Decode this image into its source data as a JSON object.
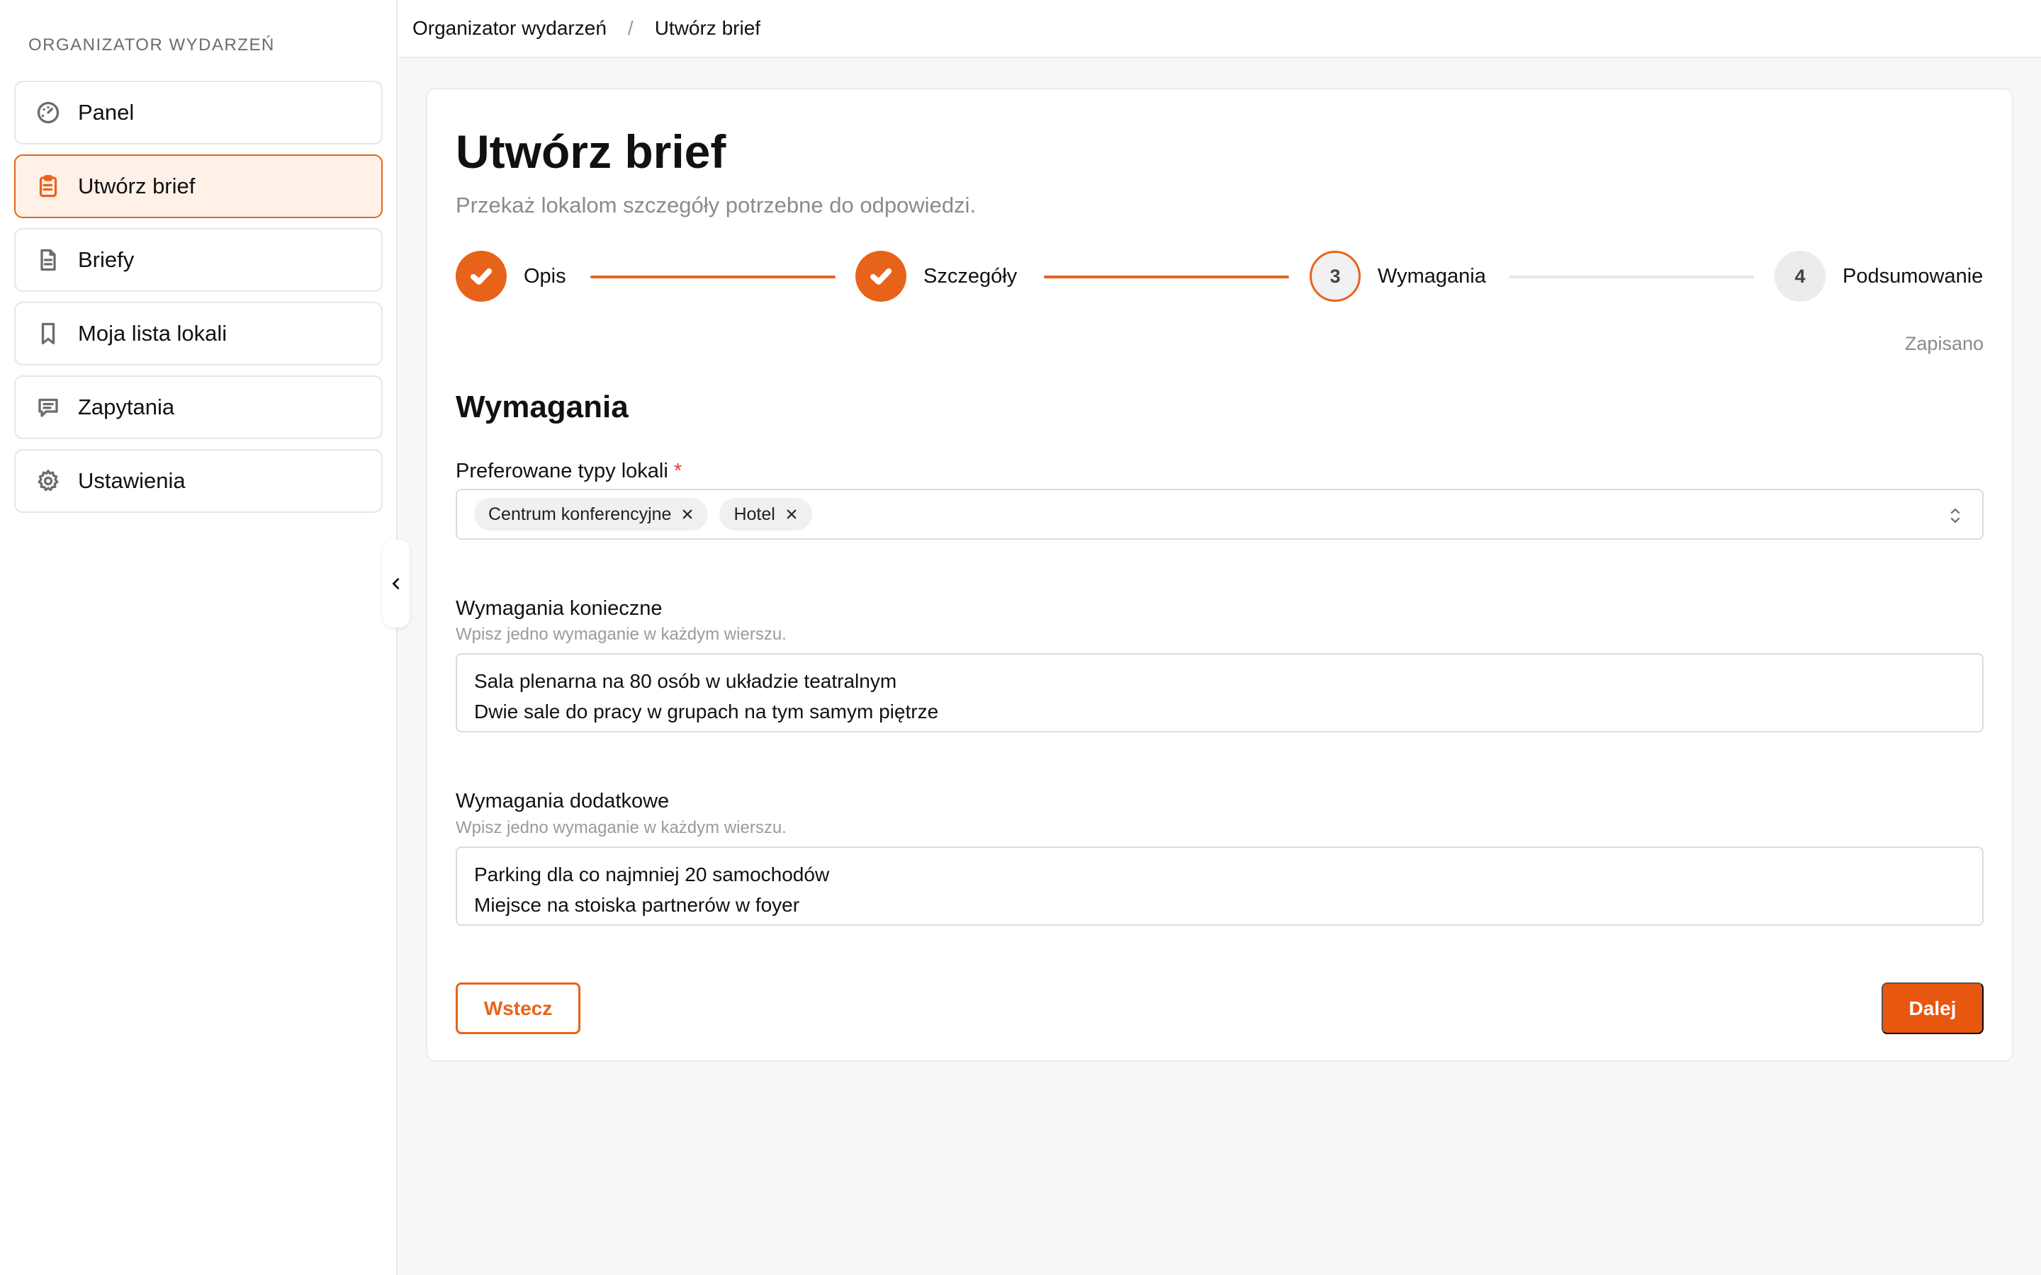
{
  "sidebar": {
    "heading": "ORGANIZATOR WYDARZEŃ",
    "items": [
      {
        "label": "Panel",
        "icon": "gauge-icon"
      },
      {
        "label": "Utwórz brief",
        "icon": "clipboard-icon"
      },
      {
        "label": "Briefy",
        "icon": "document-icon"
      },
      {
        "label": "Moja lista lokali",
        "icon": "bookmark-icon"
      },
      {
        "label": "Zapytania",
        "icon": "message-icon"
      },
      {
        "label": "Ustawienia",
        "icon": "gear-icon"
      }
    ],
    "active_index": 1
  },
  "breadcrumb": {
    "root": "Organizator wydarzeń",
    "separator": "/",
    "current": "Utwórz brief"
  },
  "page": {
    "title": "Utwórz brief",
    "subtitle": "Przekaż lokalom szczegóły potrzebne do odpowiedzi."
  },
  "stepper": {
    "steps": [
      {
        "number": "1",
        "label": "Opis",
        "state": "done"
      },
      {
        "number": "2",
        "label": "Szczegóły",
        "state": "done"
      },
      {
        "number": "3",
        "label": "Wymagania",
        "state": "current"
      },
      {
        "number": "4",
        "label": "Podsumowanie",
        "state": "pending"
      }
    ]
  },
  "save_status": "Zapisano",
  "section": {
    "title": "Wymagania",
    "venue_types": {
      "label": "Preferowane typy lokali",
      "required_mark": "*",
      "tags": [
        "Centrum konferencyjne",
        "Hotel"
      ]
    },
    "must_have": {
      "label": "Wymagania konieczne",
      "hint": "Wpisz jedno wymaganie w każdym wierszu.",
      "lines": [
        "Sala plenarna na 80 osób w układzie teatralnym",
        "Dwie sale do pracy w grupach na tym samym piętrze"
      ]
    },
    "nice_to_have": {
      "label": "Wymagania dodatkowe",
      "hint": "Wpisz jedno wymaganie w każdym wierszu.",
      "lines": [
        "Parking dla co najmniej 20 samochodów",
        "Miejsce na stoiska partnerów w foyer"
      ]
    }
  },
  "buttons": {
    "back": "Wstecz",
    "next": "Dalej"
  },
  "colors": {
    "accent": "#e8631a",
    "active_bg": "#fff1e8",
    "required": "#e23b3b"
  }
}
